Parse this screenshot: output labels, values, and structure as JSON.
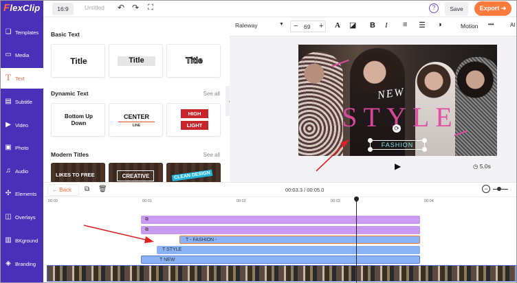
{
  "app": {
    "logo_first": "F",
    "logo_rest": "lexClip"
  },
  "sidebar": {
    "items": [
      {
        "label": "Templates",
        "icon": "layers-icon"
      },
      {
        "label": "Media",
        "icon": "folder-icon"
      },
      {
        "label": "Text",
        "icon": "text-icon"
      },
      {
        "label": "Subtitle",
        "icon": "subtitle-icon"
      },
      {
        "label": "Video",
        "icon": "video-icon"
      },
      {
        "label": "Photo",
        "icon": "photo-icon"
      },
      {
        "label": "Audio",
        "icon": "music-icon"
      },
      {
        "label": "Elements",
        "icon": "elements-icon"
      },
      {
        "label": "Overlays",
        "icon": "overlays-icon"
      },
      {
        "label": "BKground",
        "icon": "background-icon"
      },
      {
        "label": "Branding",
        "icon": "branding-icon"
      }
    ]
  },
  "topbar": {
    "ratio": "16:9",
    "title": "Untitled",
    "help": "?",
    "save": "Save",
    "export": "Export"
  },
  "panel": {
    "basic_title": "Basic Text",
    "basic_cards": [
      "Title",
      "Title",
      "Title"
    ],
    "dynamic_title": "Dynamic Text",
    "dynamic_see_all": "See all",
    "dynamic_cards": {
      "c1_line1": "Bottom Up",
      "c1_line2": "Down",
      "c2_line1": "CENTER",
      "c2_line2": "LINE",
      "c3_line1": "HIGH",
      "c3_line2": "LIGHT"
    },
    "modern_title": "Modern Titles",
    "modern_see_all": "See all",
    "modern_cards": [
      "LIKES TO FREE",
      "CREATIVE",
      "CLEAN DESIGN"
    ]
  },
  "text_toolbar": {
    "font": "Raleway",
    "size": "69",
    "motion": "Motion",
    "more": "•••",
    "cut": "Al"
  },
  "canvas": {
    "new_text": "NEW",
    "style_text": "STYLE",
    "fashion_text": "FASHION",
    "duration": "5.0s"
  },
  "timeline": {
    "back": "Back",
    "time": "00:03.3 / 00:05.0",
    "ruler": [
      "00:00",
      "00:01",
      "00:02",
      "00:03",
      "00:04"
    ],
    "tracks": {
      "fashion": "- FASHION -",
      "style": "STYLE",
      "new": "NEW"
    }
  },
  "colors": {
    "sidebar": "#4a2fb8",
    "accent": "#ff7a3d",
    "track_purple": "#c99af0",
    "track_blue": "#8ab3f5",
    "pink_text": "#e04aa0"
  }
}
